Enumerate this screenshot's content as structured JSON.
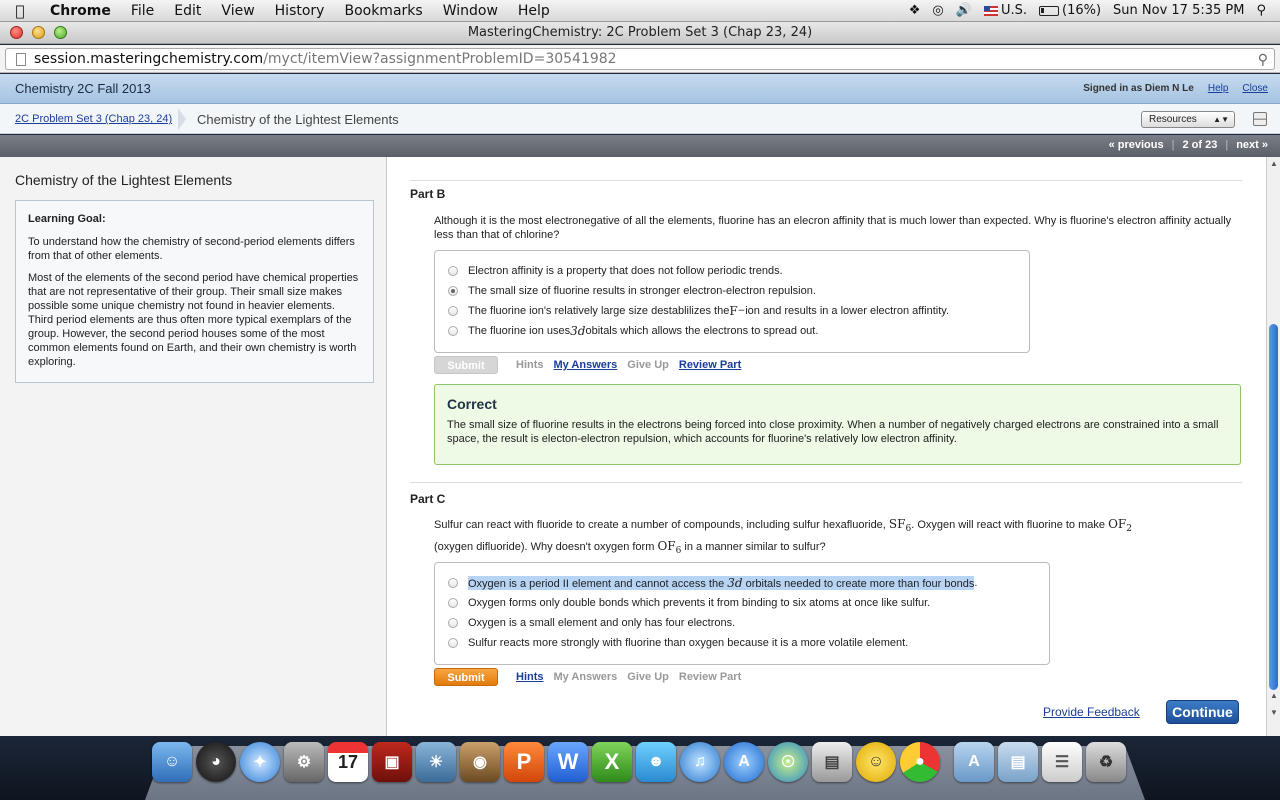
{
  "menubar": {
    "app": "Chrome",
    "items": [
      "File",
      "Edit",
      "View",
      "History",
      "Bookmarks",
      "Window",
      "Help"
    ],
    "input_source": "U.S.",
    "battery": "(16%)",
    "datetime": "Sun Nov 17  5:35 PM"
  },
  "window": {
    "title": "MasteringChemistry: 2C Problem Set 3 (Chap 23, 24)"
  },
  "address": {
    "host": "session.masteringchemistry.com",
    "path": "/myct/itemView?assignmentProblemID=30541982"
  },
  "header": {
    "course": "Chemistry 2C Fall 2013",
    "signed_in": "Signed in as Diem N Le",
    "help": "Help",
    "close": "Close"
  },
  "breadcrumb": {
    "link": "2C Problem Set 3 (Chap 23, 24)",
    "current": "Chemistry of the Lightest Elements",
    "resources": "Resources"
  },
  "pager": {
    "previous": "« previous",
    "position": "2 of 23",
    "next": "next »"
  },
  "left": {
    "title": "Chemistry of the Lightest Elements",
    "goal_heading": "Learning Goal:",
    "goal_p1": "To understand how the chemistry of second-period elements differs from that of other elements.",
    "goal_p2": "Most of the elements of the second period have chemical properties that are not representative of their group. Their small size makes possible some unique chemistry not found in heavier elements. Third period elements are thus often more typical exemplars of the group. However, the second period houses some of the most common elements found on Earth, and their own chemistry is worth exploring."
  },
  "partB": {
    "title": "Part B",
    "question": "Although it is the most electronegative of all the elements, fluorine has an elecron affinity that is much lower than expected. Why is fluorine's electron affinity actually less than that of chlorine?",
    "choices": [
      {
        "text": "Electron affinity is a property that does not follow periodic trends."
      },
      {
        "text": "The small size of fluorine results in stronger electron-electron repulsion."
      },
      {
        "pre": "The fluorine ion's relatively large size destablilizes the ",
        "math": "F",
        "sup": "−",
        "post": " ion and results in a lower electron affintity."
      },
      {
        "pre": "The fluorine ion uses ",
        "math": "3d",
        "post": " obitals which allows the electrons to spread out."
      }
    ],
    "selected_index": 1,
    "submit": "Submit",
    "hints": "Hints",
    "my_answers": "My Answers",
    "give_up": "Give Up",
    "review_part": "Review Part",
    "correct_heading": "Correct",
    "correct_text": "The small size of fluorine results in the electrons being forced into close proximity. When a number of negatively charged electrons are constrained into a small space, the result is electon-electron repulsion, which accounts for fluorine's relatively low electron affinity."
  },
  "partC": {
    "title": "Part C",
    "q_pre": "Sulfur can react with fluoride to create a number of compounds, including sulfur hexafluoride, ",
    "q_sf6": "SF",
    "q_sf6_sub": "6",
    "q_mid": ". Oxygen will react with fluorine to make ",
    "q_of2": "OF",
    "q_of2_sub": "2",
    "q_line2_pre": "(oxygen difluoride). Why doesn't oxygen form ",
    "q_of6": "OF",
    "q_of6_sub": "6",
    "q_line2_post": " in a manner similar to sulfur?",
    "choices": [
      {
        "pre": "Oxygen is a period II element and cannot access the ",
        "math": "3d",
        "post": " orbitals needed to create more than four bonds",
        "end": "."
      },
      {
        "text": "Oxygen forms only double bonds which prevents it from binding to six atoms at once like sulfur."
      },
      {
        "text": "Oxygen is a small element and only has four electrons."
      },
      {
        "text": "Sulfur reacts more strongly with fluorine than oxygen because it is a more volatile element."
      }
    ],
    "submit": "Submit",
    "hints": "Hints",
    "my_answers": "My Answers",
    "give_up": "Give Up",
    "review_part": "Review Part"
  },
  "footer": {
    "feedback": "Provide Feedback",
    "continue": "Continue"
  },
  "dock": {
    "icons": [
      "finder-icon",
      "dashboard-icon",
      "safari-icon",
      "system-preferences-icon",
      "calendar-icon",
      "photo-booth-icon",
      "iphoto-icon",
      "image-capture-icon",
      "powerpoint-icon",
      "word-icon",
      "excel-icon",
      "messenger-icon",
      "itunes-icon",
      "app-store-icon",
      "network-icon",
      "preview-icon",
      "adium-icon",
      "chrome-icon",
      "applications-folder-icon",
      "documents-folder-icon",
      "downloads-stack-icon",
      "trash-icon"
    ],
    "calendar_day": "17"
  },
  "colors": {
    "accent_orange": "#e27a0c",
    "correct_green": "#8cc66a",
    "link_blue": "#1a3d9a",
    "continue_blue": "#1d4f98"
  }
}
